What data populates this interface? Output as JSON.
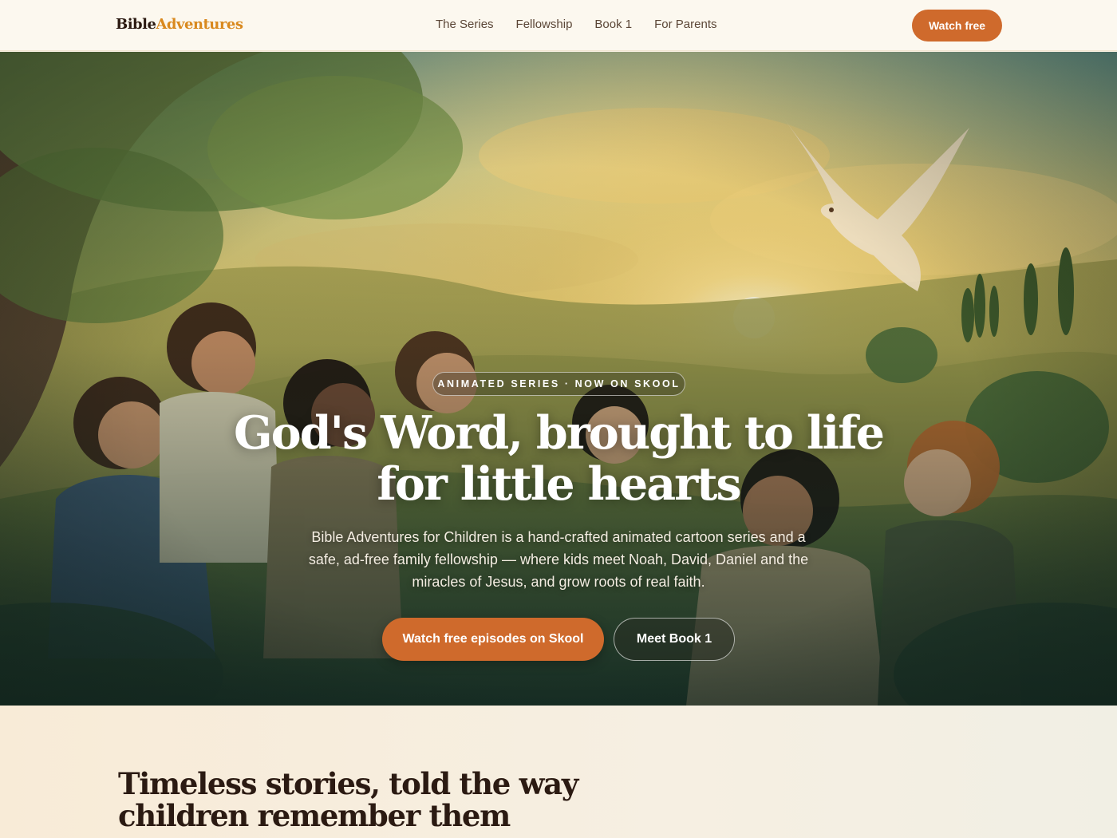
{
  "nav": {
    "logo_part1": "Bible",
    "logo_part2": "Adventures",
    "links": [
      "The Series",
      "Fellowship",
      "Book 1",
      "For Parents"
    ],
    "cta_label": "Watch free"
  },
  "hero": {
    "eyebrow": "ANIMATED SERIES · NOW ON SKOOL",
    "headline_line1": "God's Word, brought to life",
    "headline_line2": "for little hearts",
    "subtext": "Bible Adventures for Children is a hand-crafted animated cartoon series and a safe, ad-free family fellowship — where kids meet Noah, David, Daniel and the miracles of Jesus, and grow roots of real faith.",
    "primary_button": "Watch free episodes on Skool",
    "secondary_button": "Meet Book 1",
    "illustration": "dove-and-children-hillside"
  },
  "section": {
    "title_line1": "Timeless stories, told the way",
    "title_line2": "children remember them"
  },
  "colors": {
    "accent": "#cf6a2c",
    "logo_highlight": "#d9891e",
    "text_dark": "#2b1a12",
    "nav_bg": "#fcf8ef"
  }
}
